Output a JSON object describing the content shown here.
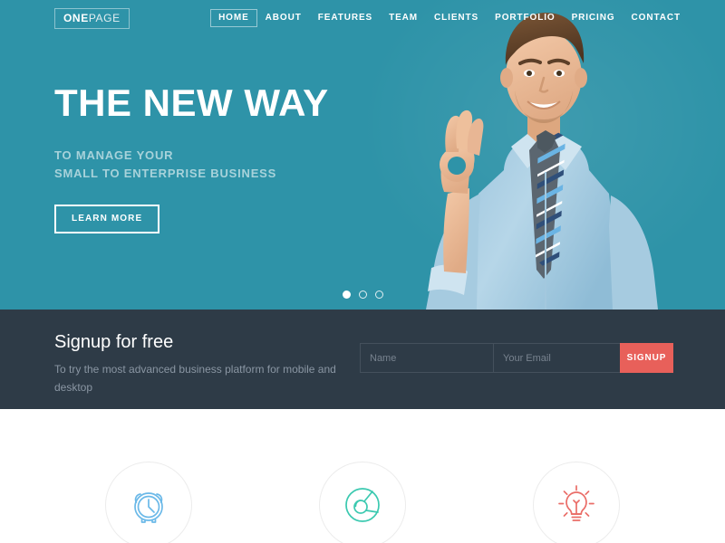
{
  "brand": {
    "name_bold": "ONE",
    "name_light": "PAGE"
  },
  "nav": {
    "items": [
      {
        "label": "HOME",
        "active": true
      },
      {
        "label": "ABOUT",
        "active": false
      },
      {
        "label": "FEATURES",
        "active": false
      },
      {
        "label": "TEAM",
        "active": false
      },
      {
        "label": "CLIENTS",
        "active": false
      },
      {
        "label": "PORTFOLIO",
        "active": false
      },
      {
        "label": "PRICING",
        "active": false
      },
      {
        "label": "CONTACT",
        "active": false
      }
    ]
  },
  "hero": {
    "title": "THE NEW WAY",
    "subtitle_line1": "TO MANAGE YOUR",
    "subtitle_line2": "SMALL TO ENTERPRISE BUSINESS",
    "cta_label": "LEARN MORE",
    "background_color": "#2e93a8",
    "image_alt": "smiling businessman in light blue shirt and striped tie making OK hand gesture",
    "slider": {
      "total": 3,
      "active_index": 0
    }
  },
  "signup": {
    "title": "Signup for free",
    "description": "To try the most advanced business platform for mobile and desktop",
    "name_placeholder": "Name",
    "name_value": "",
    "email_placeholder": "Your Email",
    "email_value": "",
    "button_label": "SIGNUP",
    "button_color": "#e8605a",
    "background_color": "#2e3b47"
  },
  "features": {
    "items": [
      {
        "icon": "alarm-clock-icon",
        "color": "#6bb9e8"
      },
      {
        "icon": "pie-chart-icon",
        "color": "#3bc9b0"
      },
      {
        "icon": "lightbulb-icon",
        "color": "#ea6d68"
      }
    ]
  }
}
